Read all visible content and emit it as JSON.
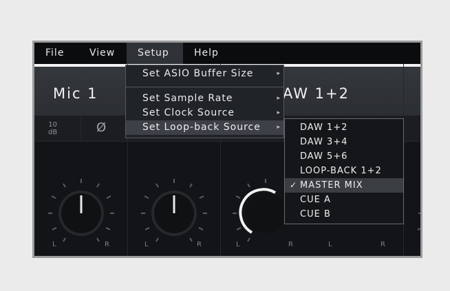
{
  "menubar": {
    "items": [
      "File",
      "View",
      "Setup",
      "Help"
    ]
  },
  "channels": {
    "titles": [
      "Mic 1",
      "AW 1+2"
    ],
    "gain": [
      "10",
      "dB"
    ],
    "phase_symbol": "Ø",
    "lr_labels": [
      "L",
      "R",
      "L",
      "R",
      "L",
      "R",
      "L",
      "R"
    ]
  },
  "setup_menu": {
    "items": [
      "Set ASIO Buffer Size",
      "Set Sample Rate",
      "Set Clock Source",
      "Set Loop-back Source"
    ],
    "highlighted": "Set Loop-back Source",
    "submenu_arrow": "▸"
  },
  "loopback_submenu": {
    "items": [
      "DAW 1+2",
      "DAW 3+4",
      "DAW 5+6",
      "LOOP-BACK 1+2",
      "MASTER MIX",
      "CUE A",
      "CUE B"
    ],
    "selected": "MASTER MIX",
    "check_mark": "✓"
  },
  "colors": {
    "background": "#ebebeb",
    "menu_bg": "#0b0c0e",
    "highlight": "#3d4046",
    "text": "#ececec"
  }
}
